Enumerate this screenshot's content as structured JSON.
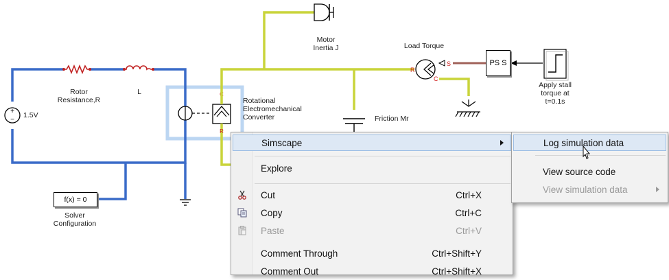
{
  "diagram": {
    "blocks": {
      "motor_inertia": "Motor\nInertia J",
      "load_torque": "Load Torque",
      "rotor_resistance": "Rotor\nResistance,R",
      "inductor": "L",
      "converter": "Rotational\nElectromechanical\nConverter",
      "friction": "Friction Mr",
      "voltage_source": "1.5V",
      "solver_block": "f(x) = 0",
      "solver_config": "Solver\nConfiguration",
      "ps_s_block": "PS S",
      "stall_torque": "Apply stall\ntorque at\nt=0.1s",
      "port_s": "S",
      "port_r": "R",
      "port_c": "C"
    }
  },
  "context_menu": {
    "items": [
      {
        "label": "Simscape",
        "submenu": true,
        "selected": true
      },
      {
        "label": "Explore"
      },
      {
        "label": "Cut",
        "shortcut": "Ctrl+X",
        "icon": "scissors-icon"
      },
      {
        "label": "Copy",
        "shortcut": "Ctrl+C",
        "icon": "copy-icon"
      },
      {
        "label": "Paste",
        "shortcut": "Ctrl+V",
        "icon": "paste-icon",
        "disabled": true
      },
      {
        "label": "Comment Through",
        "shortcut": "Ctrl+Shift+Y"
      },
      {
        "label": "Comment Out",
        "shortcut": "Ctrl+Shift+X"
      }
    ]
  },
  "simscape_submenu": {
    "items": [
      {
        "label": "Log simulation data",
        "selected": true
      },
      {
        "label": "View source code"
      },
      {
        "label": "View simulation data",
        "submenu": true,
        "disabled": true
      }
    ]
  },
  "colors": {
    "electrical_wire": "#3a6bc8",
    "mechanical_wire": "#c9d43a",
    "physical_signal_wire": "#a0625a",
    "selection_box": "#bcd6f2",
    "menu_highlight": "#dde8f5",
    "port_red": "#d02020"
  }
}
